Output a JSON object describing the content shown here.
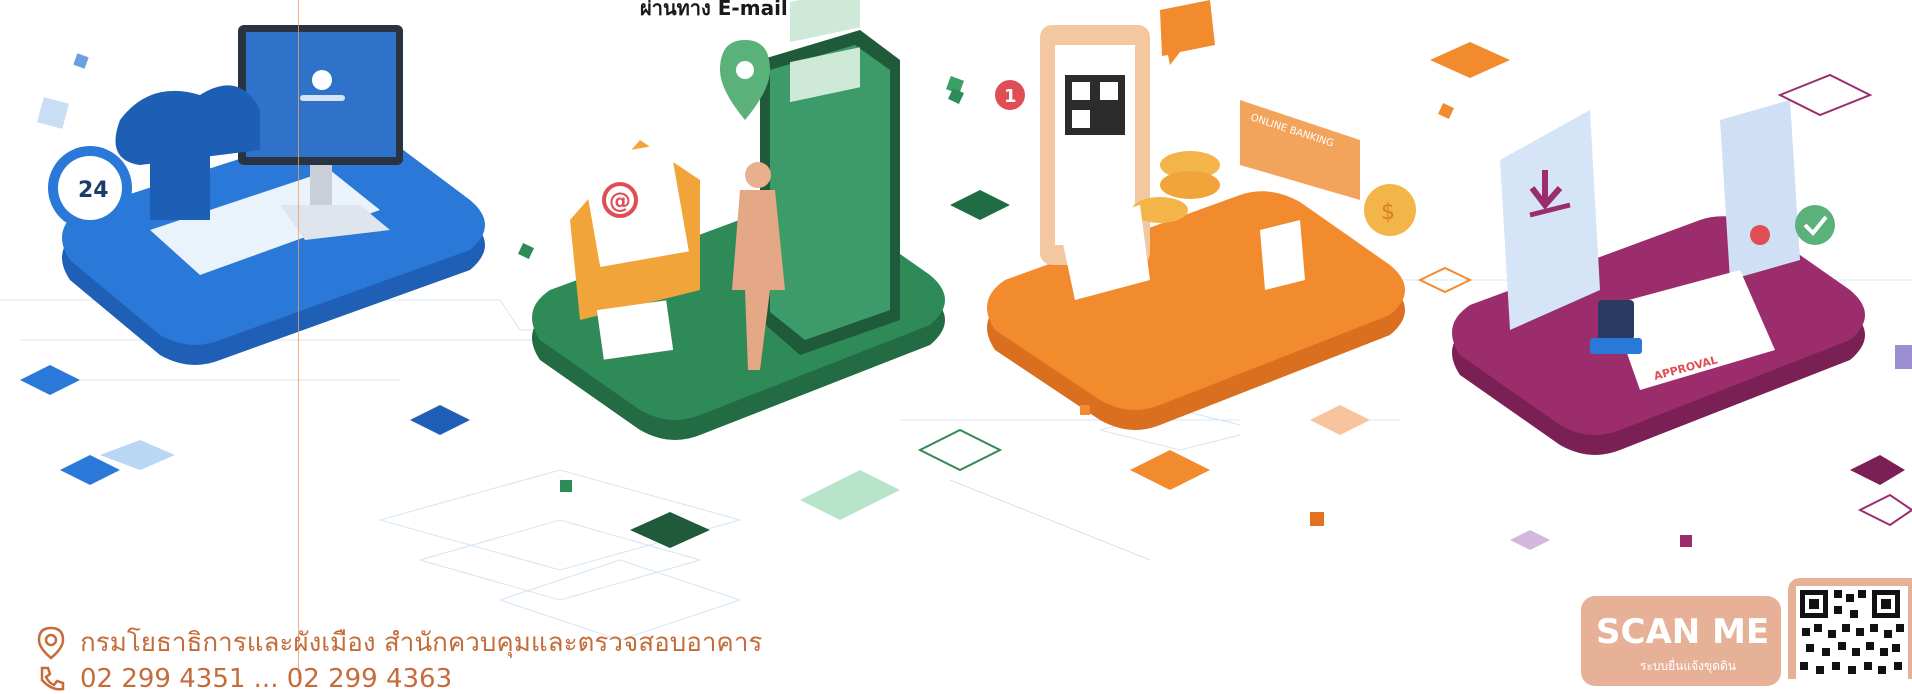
{
  "header": {
    "caption": "ผ่านทาง E-mail"
  },
  "tiles": [
    {
      "id": "computer",
      "color": "#2a78d8",
      "icon": "computer-key-icon",
      "badge": "24"
    },
    {
      "id": "email",
      "color": "#2e8b57",
      "icon": "email-phone-icon",
      "badge": "@"
    },
    {
      "id": "payment",
      "color": "#f28a2e",
      "icon": "payment-qr-icon",
      "badge": "1",
      "screen_text": "ONLINE BANKING"
    },
    {
      "id": "approval",
      "color": "#9c2d6d",
      "icon": "document-approval-icon",
      "stamp_text": "APPROVAL"
    }
  ],
  "footer": {
    "address": "กรมโยธาธิการและผังเมือง สำนักควบคุมและตรวจสอบอาคาร",
    "phone": "02 299 4351 ... 02 299 4363",
    "scan_title": "SCAN ME",
    "scan_subtitle": "ระบบยื่นแจ้งขุดดิน"
  },
  "colors": {
    "accent_orange": "#c56c3a",
    "scan_bg": "#e7b197",
    "blue": "#2a78d8",
    "green": "#2e8b57",
    "orange": "#f28a2e",
    "purple": "#9c2d6d"
  }
}
